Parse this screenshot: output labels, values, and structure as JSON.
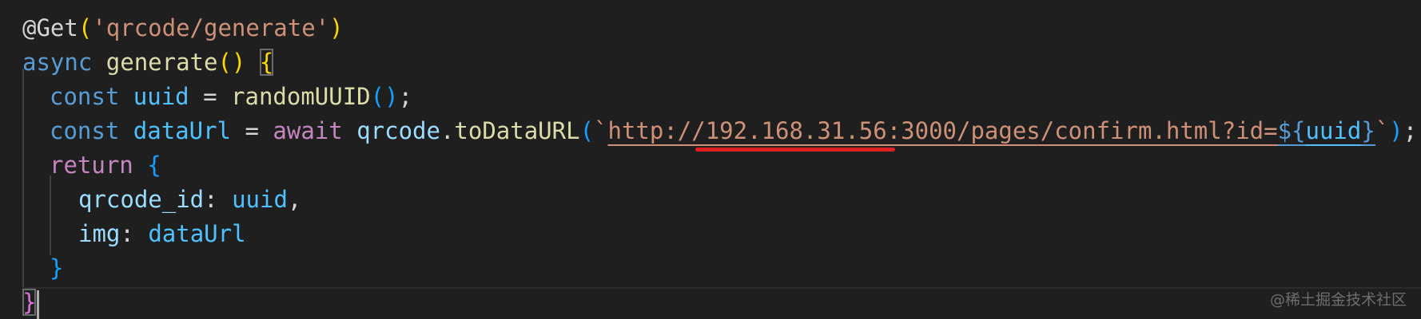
{
  "code": {
    "line1": {
      "decorator": "@Get",
      "open_paren": "(",
      "string": "'qrcode/generate'",
      "close_paren": ")"
    },
    "line2": {
      "keyword": "async",
      "function_name": "generate",
      "parens": "()",
      "open_brace": "{"
    },
    "line3": {
      "keyword": "const",
      "variable": "uuid",
      "operator": "=",
      "call": "randomUUID",
      "parens": "()",
      "semicolon": ";"
    },
    "line4": {
      "keyword": "const",
      "variable": "dataUrl",
      "operator": "=",
      "await": "await",
      "object": "qrcode",
      "dot": ".",
      "method": "toDataURL",
      "open_paren": "(",
      "backtick_open": "`",
      "url_prefix": "http://",
      "url_ip": "192.168.31.56",
      "url_rest": ":3000/pages/confirm.html?id=",
      "tpl_open": "${",
      "tpl_var": "uuid",
      "tpl_close": "}",
      "backtick_close": "`",
      "close_paren": ")",
      "semicolon": ";"
    },
    "line5": {
      "keyword": "return",
      "open_brace": "{"
    },
    "line6": {
      "key": "qrcode_id",
      "colon": ":",
      "value": "uuid",
      "comma": ","
    },
    "line7": {
      "key": "img",
      "colon": ":",
      "value": "dataUrl"
    },
    "line8": {
      "close_brace": "}"
    },
    "line9": {
      "close_brace": "}"
    }
  },
  "watermark": "@稀土掘金技术社区",
  "colors": {
    "background": "#1f1f1f",
    "keyword": "#569cd6",
    "control": "#c586c0",
    "function": "#dcdcaa",
    "variable": "#9cdcfe",
    "constant": "#4fc1ff",
    "string": "#ce9178",
    "annotation_underline": "#e02020"
  }
}
